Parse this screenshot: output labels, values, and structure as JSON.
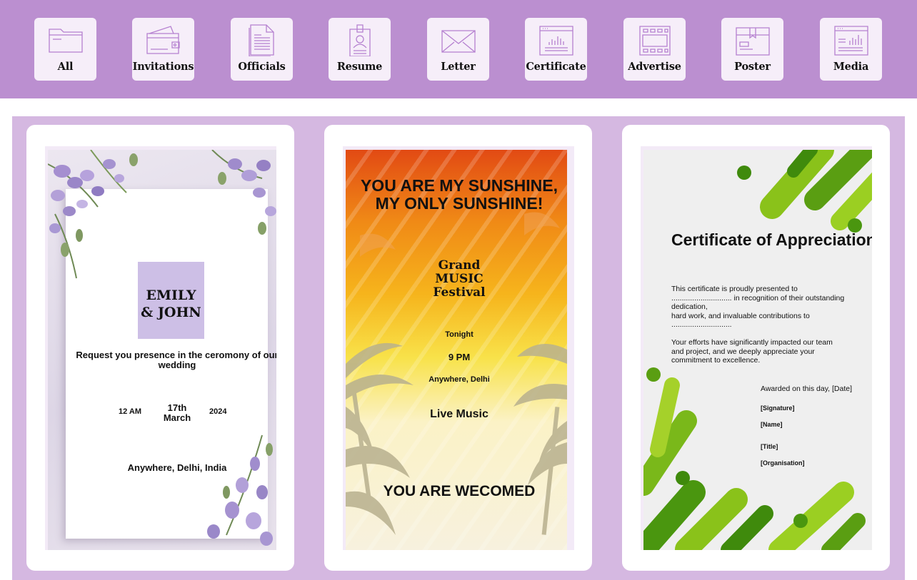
{
  "categories": [
    {
      "label": "All",
      "icon": "folder-icon"
    },
    {
      "label": "Invitations",
      "icon": "wallet-card-icon"
    },
    {
      "label": "Officials",
      "icon": "document-icon"
    },
    {
      "label": "Resume",
      "icon": "id-badge-icon"
    },
    {
      "label": "Letter",
      "icon": "envelope-icon"
    },
    {
      "label": "Certificate",
      "icon": "chart-window-icon"
    },
    {
      "label": "Advertise",
      "icon": "billboard-icon"
    },
    {
      "label": "Poster",
      "icon": "package-box-icon"
    },
    {
      "label": "Media",
      "icon": "media-window-icon"
    }
  ],
  "colors": {
    "category_bar": "#bb8fd0",
    "category_tile": "#f6eef9",
    "gallery_bg": "#d5b8e1",
    "card_bg": "#ffffff",
    "icon_stroke": "#b580d0"
  },
  "templates": {
    "wedding": {
      "names": "EMILY\n& JOHN",
      "request": "Request you presence in the ceromony of our wedding",
      "time": "12 AM",
      "date": "17th\nMarch",
      "year": "2024",
      "place": "Anywhere, Delhi, India"
    },
    "festival": {
      "headline": "YOU ARE MY SUNSHINE,\nMY ONLY SUNSHINE!",
      "event": "Grand\nMUSIC\nFestival",
      "when": "Tonight",
      "time": "9 PM",
      "place": "Anywhere, Delhi",
      "feature": "Live Music",
      "welcome": "YOU ARE WECOMED"
    },
    "certificate": {
      "title": "Certificate of Appreciation",
      "body": "This certificate is proudly presented to\n............................. in recognition of their outstanding dedication,\nhard work, and invaluable contributions to\n.............................",
      "impact": "Your efforts have significantly impacted our team\nand project, and we deeply appreciate your\ncommitment to excellence.",
      "awarded": "Awarded on this day, [Date]",
      "signature": "[Signature]",
      "name": "[Name]",
      "role": "[Title]",
      "organisation": "[Organisation]"
    }
  }
}
